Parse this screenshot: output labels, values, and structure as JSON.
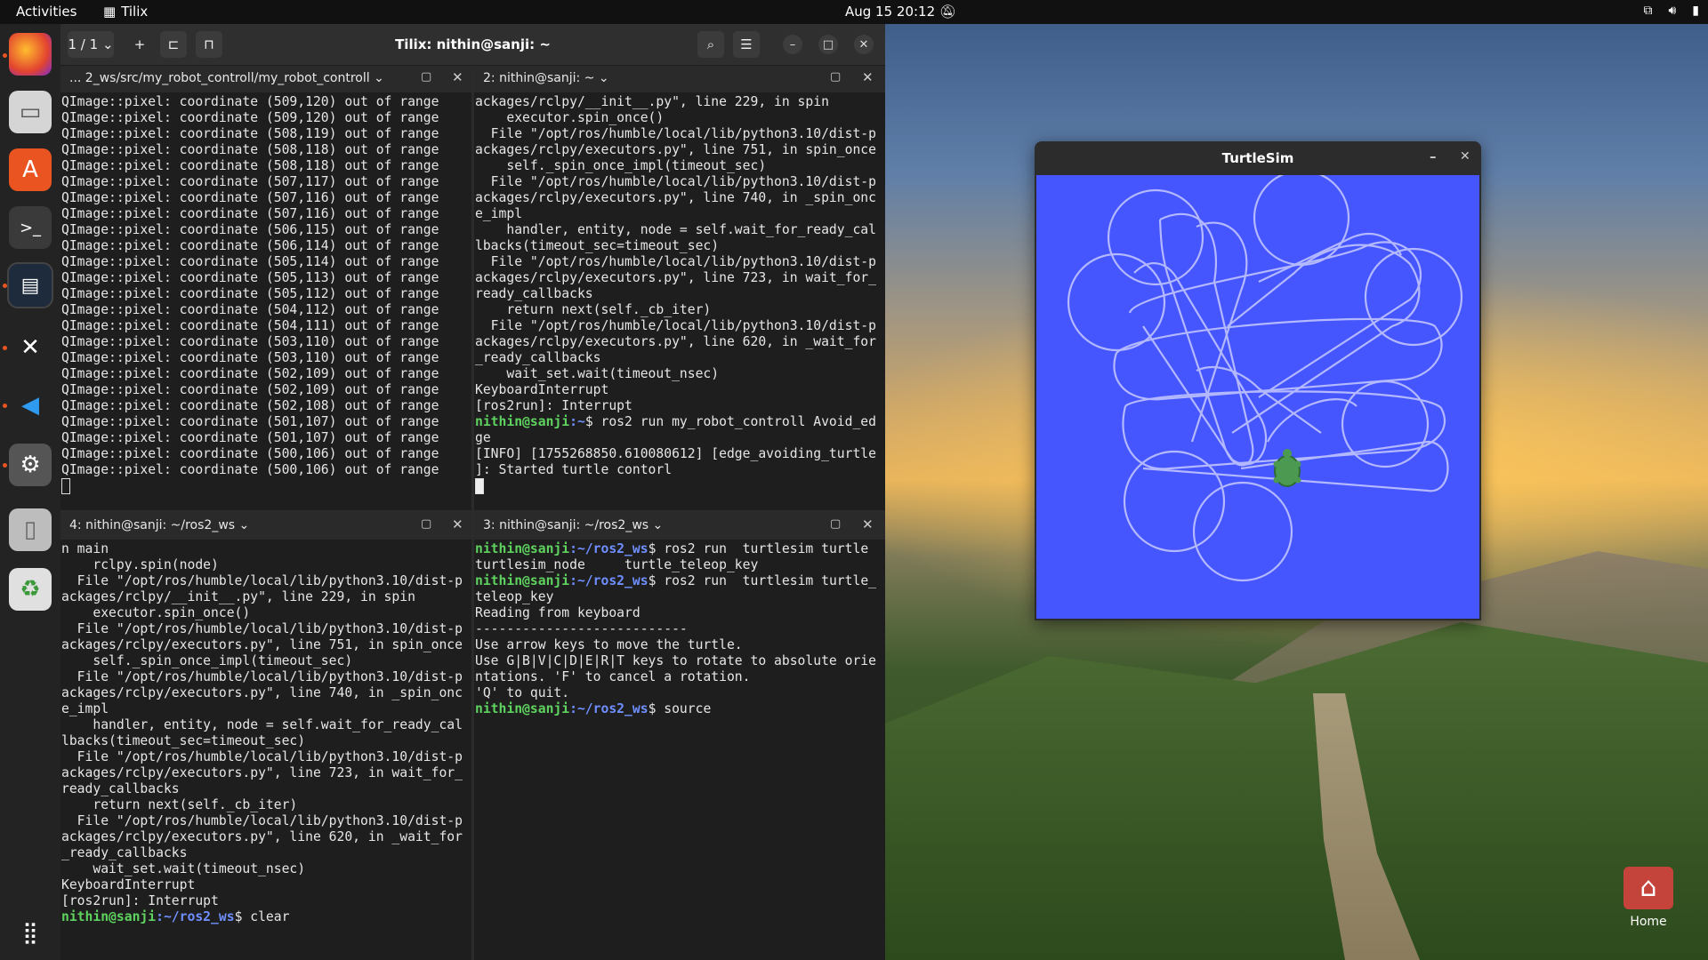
{
  "topbar": {
    "activities": "Activities",
    "app_name": "Tilix",
    "datetime": "Aug 15  20:12",
    "tray_icons": [
      "network-icon",
      "volume-icon",
      "battery-icon"
    ]
  },
  "dock": {
    "items": [
      "firefox",
      "files",
      "app-center",
      "terminal",
      "tilix",
      "tools",
      "vscode",
      "settings",
      "removable-drive",
      "trash"
    ]
  },
  "tilix": {
    "session_label": "1 / 1",
    "title": "Tilix: nithin@sanji: ~",
    "panes": {
      "p1": {
        "title": "... 2_ws/src/my_robot_controll/my_robot_controll",
        "lines": [
          "QImage::pixel: coordinate (509,120) out of range",
          "QImage::pixel: coordinate (509,120) out of range",
          "QImage::pixel: coordinate (508,119) out of range",
          "QImage::pixel: coordinate (508,118) out of range",
          "QImage::pixel: coordinate (508,118) out of range",
          "QImage::pixel: coordinate (507,117) out of range",
          "QImage::pixel: coordinate (507,116) out of range",
          "QImage::pixel: coordinate (507,116) out of range",
          "QImage::pixel: coordinate (506,115) out of range",
          "QImage::pixel: coordinate (506,114) out of range",
          "QImage::pixel: coordinate (505,114) out of range",
          "QImage::pixel: coordinate (505,113) out of range",
          "QImage::pixel: coordinate (505,112) out of range",
          "QImage::pixel: coordinate (504,112) out of range",
          "QImage::pixel: coordinate (504,111) out of range",
          "QImage::pixel: coordinate (503,110) out of range",
          "QImage::pixel: coordinate (503,110) out of range",
          "QImage::pixel: coordinate (502,109) out of range",
          "QImage::pixel: coordinate (502,109) out of range",
          "QImage::pixel: coordinate (502,108) out of range",
          "QImage::pixel: coordinate (501,107) out of range",
          "QImage::pixel: coordinate (501,107) out of range",
          "QImage::pixel: coordinate (500,106) out of range",
          "QImage::pixel: coordinate (500,106) out of range"
        ]
      },
      "p2": {
        "title": "2: nithin@sanji: ~",
        "lines": [
          "ackages/rclpy/__init__.py\", line 229, in spin",
          "    executor.spin_once()",
          "  File \"/opt/ros/humble/local/lib/python3.10/dist-p",
          "ackages/rclpy/executors.py\", line 751, in spin_once",
          "    self._spin_once_impl(timeout_sec)",
          "  File \"/opt/ros/humble/local/lib/python3.10/dist-p",
          "ackages/rclpy/executors.py\", line 740, in _spin_onc",
          "e_impl",
          "    handler, entity, node = self.wait_for_ready_cal",
          "lbacks(timeout_sec=timeout_sec)",
          "  File \"/opt/ros/humble/local/lib/python3.10/dist-p",
          "ackages/rclpy/executors.py\", line 723, in wait_for_",
          "ready_callbacks",
          "    return next(self._cb_iter)",
          "  File \"/opt/ros/humble/local/lib/python3.10/dist-p",
          "ackages/rclpy/executors.py\", line 620, in _wait_for",
          "_ready_callbacks",
          "    wait_set.wait(timeout_nsec)",
          "KeyboardInterrupt",
          "[ros2run]: Interrupt"
        ],
        "prompt_user": "nithin@sanji",
        "prompt_path": ":~",
        "prompt_cmd": "$ ros2 run my_robot_controll Avoid_ed",
        "after_lines": [
          "ge",
          "[INFO] [1755268850.610080612] [edge_avoiding_turtle",
          "]: Started turtle contorl"
        ]
      },
      "p4": {
        "title": "4: nithin@sanji: ~/ros2_ws",
        "lines": [
          "n main",
          "    rclpy.spin(node)",
          "  File \"/opt/ros/humble/local/lib/python3.10/dist-p",
          "ackages/rclpy/__init__.py\", line 229, in spin",
          "    executor.spin_once()",
          "  File \"/opt/ros/humble/local/lib/python3.10/dist-p",
          "ackages/rclpy/executors.py\", line 751, in spin_once",
          "    self._spin_once_impl(timeout_sec)",
          "  File \"/opt/ros/humble/local/lib/python3.10/dist-p",
          "ackages/rclpy/executors.py\", line 740, in _spin_onc",
          "e_impl",
          "    handler, entity, node = self.wait_for_ready_cal",
          "lbacks(timeout_sec=timeout_sec)",
          "  File \"/opt/ros/humble/local/lib/python3.10/dist-p",
          "ackages/rclpy/executors.py\", line 723, in wait_for_",
          "ready_callbacks",
          "    return next(self._cb_iter)",
          "  File \"/opt/ros/humble/local/lib/python3.10/dist-p",
          "ackages/rclpy/executors.py\", line 620, in _wait_for",
          "_ready_callbacks",
          "    wait_set.wait(timeout_nsec)",
          "KeyboardInterrupt",
          "[ros2run]: Interrupt"
        ],
        "prompt_user": "nithin@sanji",
        "prompt_path": ":~/ros2_ws",
        "prompt_cmd": "$ clear"
      },
      "p3": {
        "title": "3: nithin@sanji: ~/ros2_ws",
        "prompt_user": "nithin@sanji",
        "prompt_path": ":~/ros2_ws",
        "cmd1": "$ ros2 run  turtlesim turtle",
        "cmd1_out": "turtlesim_node     turtle_teleop_key",
        "cmd2": "$ ros2 run  turtlesim turtle_",
        "cmd2_lines": [
          "teleop_key",
          "Reading from keyboard",
          "---------------------------",
          "Use arrow keys to move the turtle.",
          "Use G|B|V|C|D|E|R|T keys to rotate to absolute orie",
          "ntations. 'F' to cancel a rotation.",
          "'Q' to quit."
        ],
        "cmd3": "$ source "
      }
    }
  },
  "turtlesim": {
    "title": "TurtleSim",
    "background_color": "#4556ff",
    "pen_color": "#b3b8ff"
  },
  "desktop": {
    "home_label": "Home"
  }
}
